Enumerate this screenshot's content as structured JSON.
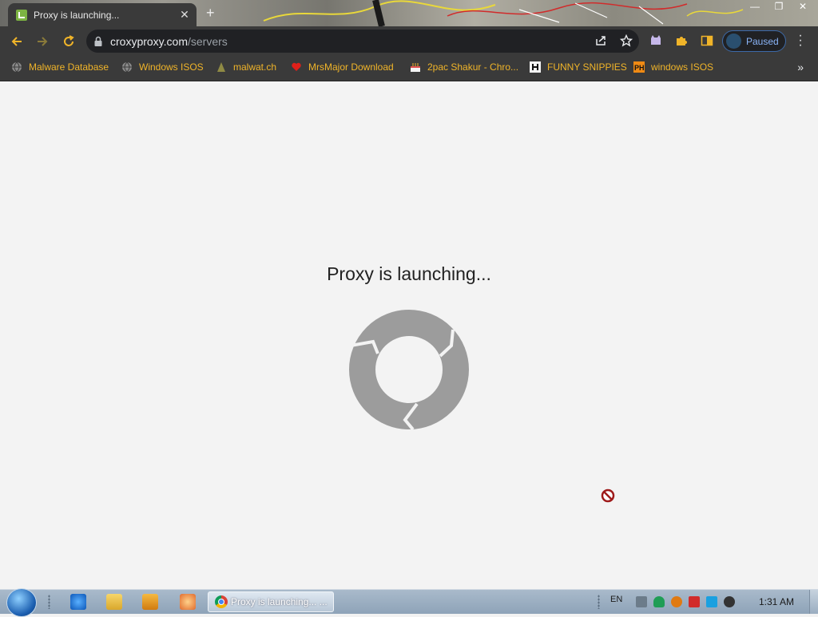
{
  "browser": {
    "tab": {
      "title": "Proxy is launching...",
      "close": "✕"
    },
    "window_controls": [
      "—",
      "❐",
      "✕"
    ],
    "address": {
      "host": "croxyproxy.com",
      "path": "/servers"
    },
    "profile_status": "Paused",
    "bookmarks": [
      {
        "label": "Malware Database",
        "icon": "globe-icon"
      },
      {
        "label": "Windows ISOS",
        "icon": "globe-icon"
      },
      {
        "label": "malwat.ch",
        "icon": "malware-icon"
      },
      {
        "label": "MrsMajor Download",
        "icon": "heart-icon"
      },
      {
        "label": "2pac Shakur - Chro...",
        "icon": "cake-icon"
      },
      {
        "label": "FUNNY SNIPPIES",
        "icon": "h-icon"
      },
      {
        "label": "windows ISOS",
        "icon": "ph-icon"
      }
    ],
    "overflow": "»"
  },
  "page": {
    "heading": "Proxy is launching..."
  },
  "taskbar": {
    "task_label": "Proxy is launching... ...",
    "language": "EN",
    "clock": "1:31 AM"
  },
  "colors": {
    "bookmark_text": "#f0b429",
    "accent_blue": "#8ab4f8",
    "spinner": "#9c9c9c",
    "page_bg": "#f3f3f3"
  }
}
